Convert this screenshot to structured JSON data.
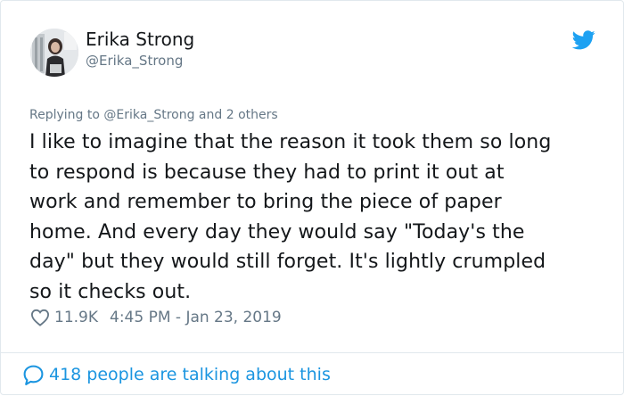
{
  "tweet": {
    "author_name": "Erika Strong",
    "author_handle": "@Erika_Strong",
    "reply_prefix": "Replying to ",
    "reply_mention": "@Erika_Strong",
    "reply_suffix": " and 2 others",
    "text_lines": [
      "I like to imagine that the reason it took them so long",
      "to respond is because they had to print it out at",
      "work and remember to bring the piece of paper",
      "home. And every day they would say \"Today's the",
      "day\" but they would still forget. It's lightly crumpled",
      "so it checks out."
    ],
    "likes": "11.9K",
    "timestamp": "4:45 PM - Jan 23, 2019",
    "talking_about": "418 people are talking about this"
  },
  "icons": {
    "platform": "twitter-bird-icon",
    "like": "heart-outline-icon",
    "comment": "speech-bubble-icon"
  },
  "colors": {
    "twitter_blue": "#1da1f2",
    "link_blue": "#1b95e0",
    "muted_text": "#657786",
    "primary_text": "#14171a",
    "border": "#e1e8ed"
  }
}
